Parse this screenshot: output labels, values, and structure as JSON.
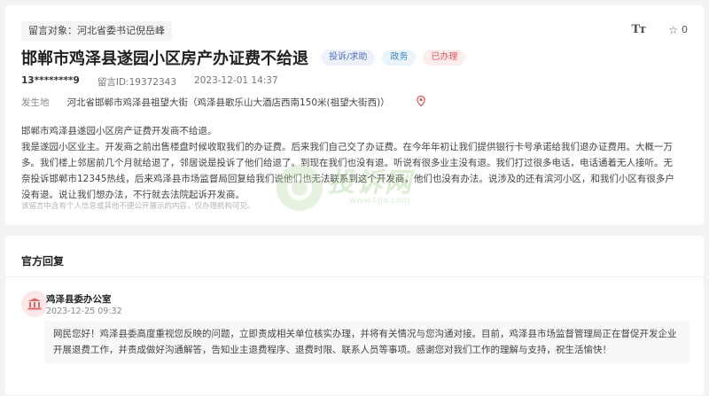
{
  "header": {
    "target_label": "留言对象：河北省委书记倪岳峰",
    "font_size_tool_label": "Tт",
    "favorite_count": "0",
    "title": "邯郸市鸡泽县遂园小区房产办证费不给退",
    "badges": {
      "type": "投诉/求助",
      "domain": "政务",
      "status": "已办理"
    },
    "colors": {
      "status_red": "#e05454",
      "type_blue": "#4c6fbf",
      "domain_blue": "#3f86c4"
    }
  },
  "meta": {
    "user": "13********9",
    "message_id": "留言ID:19372343",
    "datetime": "2023-12-01 14:37"
  },
  "location": {
    "label": "发生地",
    "address": "河北省邯郸市鸡泽县祖望大街（鸡泽县歌乐山大酒店西南150米(祖望大街西)）",
    "icon": "map-pin-icon"
  },
  "body": {
    "subject": "邯郸市鸡泽县遂园小区房产证费开发商不给退。",
    "content": "我是遂园小区业主。开发商之前出售楼盘时候收取我们的办证费。后来我们自己交了办证费。在今年年初让我们提供银行卡号承诺给我们退办证费用。大概一万多。我们楼上邻居前几个月就给退了，邻居说是投诉了他们给退了。到现在我们也没有退。听说有很多业主没有退。我们打过很多电话，电话通着无人接听。无奈投诉邯郸市12345热线，后来鸡泽县市场监督局回复给我们说他们也无法联系到这个开发商，他们也没有办法。说涉及的还有滨河小区，和我们小区有很多户没有退。说让我们想办法，不行就去法院起诉开发商。",
    "notice": "该留言中含有个人信息或其他不便公开展示的内容，仅办理机构可见。"
  },
  "watermark": {
    "text": "投诉网",
    "url": "www.Ljia.com"
  },
  "reply": {
    "section_title": "官方回复",
    "org": "鸡泽县委办公室",
    "date": "2023-12-25 09:32",
    "content": "网民您好！鸡泽县委高度重视您反映的问题，立即责成相关单位核实办理，并将有关情况与您沟通对接。目前，鸡泽县市场监督管理局正在督促开发企业开展退费工作，并责成做好沟通解答，告知业主退费程序、退费时限、联系人员等事项。感谢您对我们工作的理解与支持，祝生活愉快！",
    "icon": "government-building-icon"
  }
}
